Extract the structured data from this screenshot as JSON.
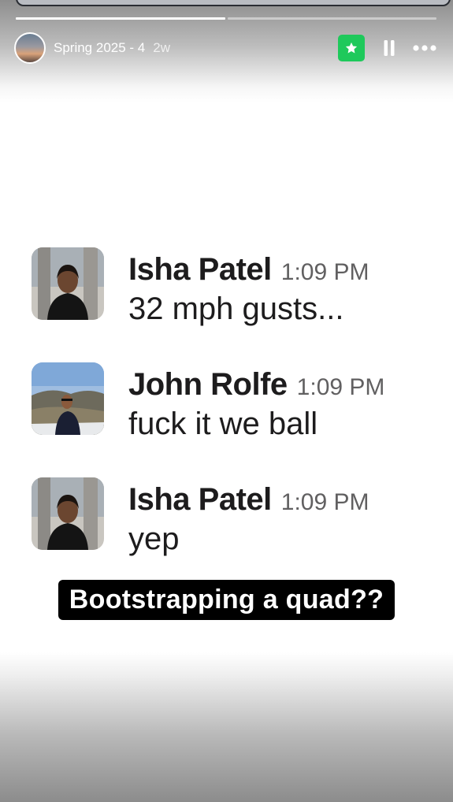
{
  "story": {
    "title": "Spring 2025 - 4",
    "age": "2w",
    "segments_total": 2,
    "segments_viewed": 1
  },
  "colors": {
    "star_button": "#1ec95b",
    "caption_bg": "#000000",
    "caption_text": "#ffffff"
  },
  "icons": {
    "star": "star-icon",
    "pause": "pause-icon",
    "more": "more-icon"
  },
  "messages": [
    {
      "name": "Isha Patel",
      "time": "1:09 PM",
      "text": "32 mph gusts..."
    },
    {
      "name": "John Rolfe",
      "time": "1:09 PM",
      "text": "fuck it we ball"
    },
    {
      "name": "Isha Patel",
      "time": "1:09 PM",
      "text": "yep"
    }
  ],
  "caption": "Bootstrapping a quad??"
}
